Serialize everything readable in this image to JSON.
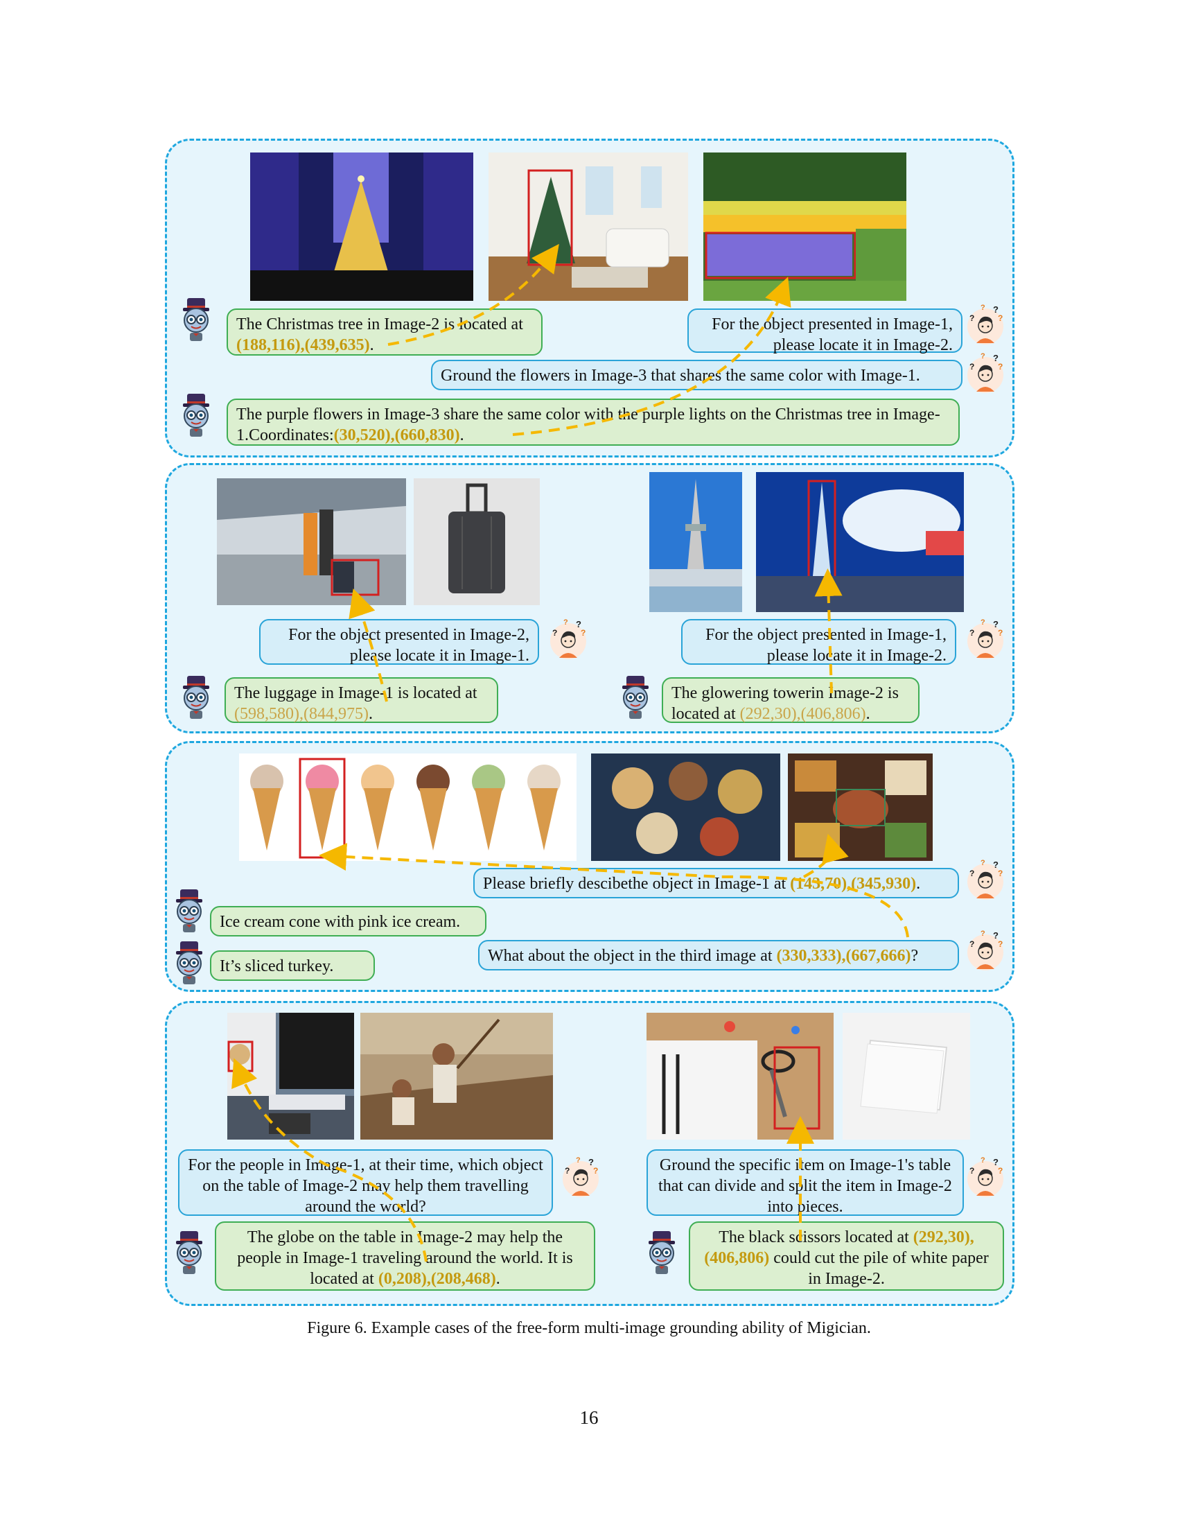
{
  "figure": {
    "caption": "Figure 6. Example cases of the free-form multi-image grounding ability of Migician.",
    "page_number": "16"
  },
  "icons": {
    "assistant": "robot-mascot-icon",
    "user": "confused-user-icon"
  },
  "colors": {
    "question_bg": "#d6eef9",
    "answer_bg": "#dcefd0",
    "coordinate": "#c49a10",
    "arrow": "#f5b800",
    "panel_border": "#1ea7df"
  },
  "panel1": {
    "a1": {
      "prefix": "The Christmas tree in Image-2 is located at ",
      "coords": "(188,116),(439,635)",
      "suffix": "."
    },
    "q1": "For the object presented in Image-1, please locate it in Image-2.",
    "q2": "Ground the flowers in Image-3 that shares the same color with Image-1.",
    "a2": {
      "prefix": "The purple flowers in Image-3 share the same color with the purple lights on the Christmas tree in Image-1.Coordinates:",
      "coords": "(30,520),(660,830)",
      "suffix": "."
    }
  },
  "panel2": {
    "q_left": "For the object presented in Image-2, please locate it in Image-1.",
    "a_left": {
      "prefix": "The luggage in Image-1 is located at ",
      "coords": "(598,580),(844,975)",
      "suffix": "."
    },
    "q_right": "For the object presented in Image-1, please locate it in Image-2.",
    "a_right": {
      "prefix": "The glowering towerin Image-2 is located at ",
      "coords": "(292,30),(406,806)",
      "suffix": "."
    }
  },
  "panel3": {
    "q1": {
      "prefix": "Please briefly descibethe object in Image-1 at ",
      "coords": "(143,70),(345,930)",
      "suffix": "."
    },
    "a1": "Ice cream cone with pink ice cream.",
    "q2": {
      "prefix": "What about the object in the third image at ",
      "coords": "(330,333),(667,666)",
      "suffix": "?"
    },
    "a2": "It’s sliced turkey."
  },
  "panel4": {
    "q_left": "For the people in Image-1, at their time, which object on the table of Image-2 may help them travelling around the world?",
    "a_left": {
      "prefix": "The globe on the table in Image-2 may help the people in Image-1 traveling around the world. It is located at ",
      "coords": "(0,208),(208,468)",
      "suffix": "."
    },
    "q_right": "Ground the specific item on Image-1's table that can divide and split the item in Image-2 into pieces.",
    "a_right": {
      "pre": "The black scissors located at ",
      "coords": "(292,30),(406,806)",
      "suffix": " could cut the pile of white paper in Image-2."
    }
  }
}
